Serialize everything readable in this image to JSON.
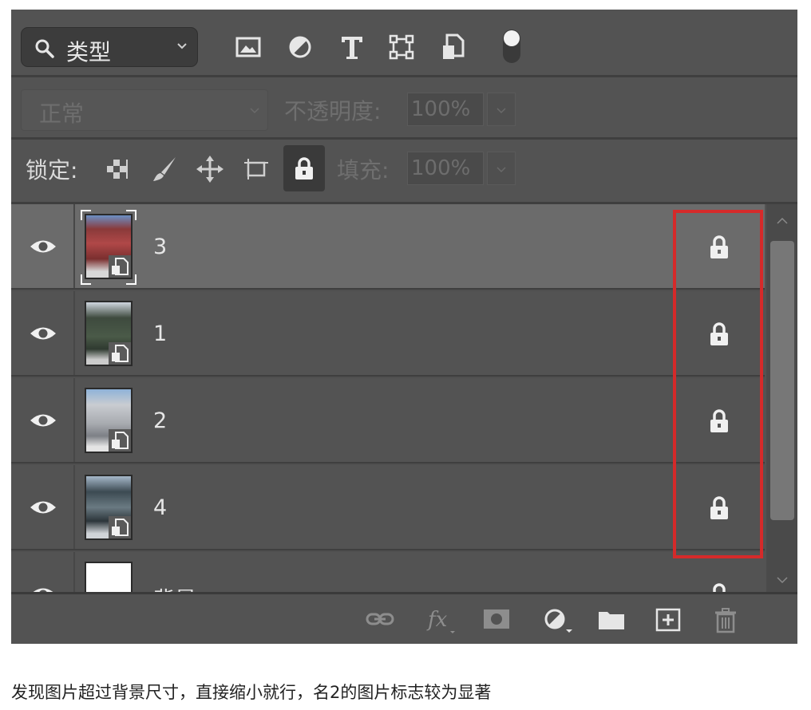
{
  "filter": {
    "kind_label": "类型"
  },
  "blend": {
    "mode_label": "正常",
    "opacity_label": "不透明度:",
    "opacity_value": "100%"
  },
  "lock": {
    "label": "锁定:",
    "fill_label": "填充:",
    "fill_value": "100%"
  },
  "layers": [
    {
      "name": "3",
      "selected": true
    },
    {
      "name": "1",
      "selected": false
    },
    {
      "name": "2",
      "selected": false
    },
    {
      "name": "4",
      "selected": false
    },
    {
      "name": "背景",
      "selected": false
    }
  ],
  "caption": "发现图片超过背景尺寸，直接缩小就行，名2的图片标志较为显著",
  "colors": {
    "panel": "#535353",
    "selected_row": "#6b6b6b",
    "highlight": "#d52a2a"
  }
}
